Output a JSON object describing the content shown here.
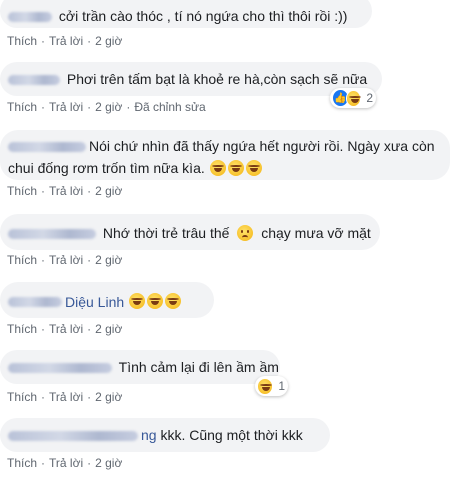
{
  "colors": {
    "bubble": "#f2f3f5",
    "link": "#385898",
    "meta": "#606770",
    "like_blue": "#1877f2"
  },
  "actions": {
    "like": "Thích",
    "reply": "Trả lời",
    "sep": "·",
    "edited": "Đã chỉnh sửa"
  },
  "comments": [
    {
      "text": "cởi trần cào thóc , tí nó ngứa cho thì thôi rồi :))",
      "time": "2 giờ"
    },
    {
      "text": "Phơi trên tấm bạt là khoẻ re hà,còn sạch sẽ nữa",
      "time": "2 giờ",
      "reaction_count": "2",
      "reaction_icons": [
        "like-icon",
        "laugh-icon"
      ]
    },
    {
      "text_line1": "Nói chứ nhìn đã thấy ngứa hết người rồi. Ngày xưa còn",
      "text_line2": "chui đống rơm trốn tìm nữa kìa.",
      "time": "2 giờ",
      "emojis": [
        "laugh-icon",
        "laugh-icon",
        "laugh-icon"
      ]
    },
    {
      "text": "Nhớ thời trẻ trâu thế",
      "text_after": "chạy mưa vỡ mặt",
      "time": "2 giờ",
      "emoji": "sad-icon"
    },
    {
      "name": "Diệu Linh",
      "time": "2 giờ",
      "emojis": [
        "laugh-icon",
        "laugh-icon",
        "laugh-icon"
      ]
    },
    {
      "text": "Tình cảm lại đi lên ầm ầm",
      "time": "2 giờ",
      "reaction_count": "1",
      "reaction_icons": [
        "laugh-icon"
      ]
    },
    {
      "name_suffix": "ng",
      "text": "kkk. Cũng một thời kkk",
      "time": "2 giờ"
    }
  ]
}
